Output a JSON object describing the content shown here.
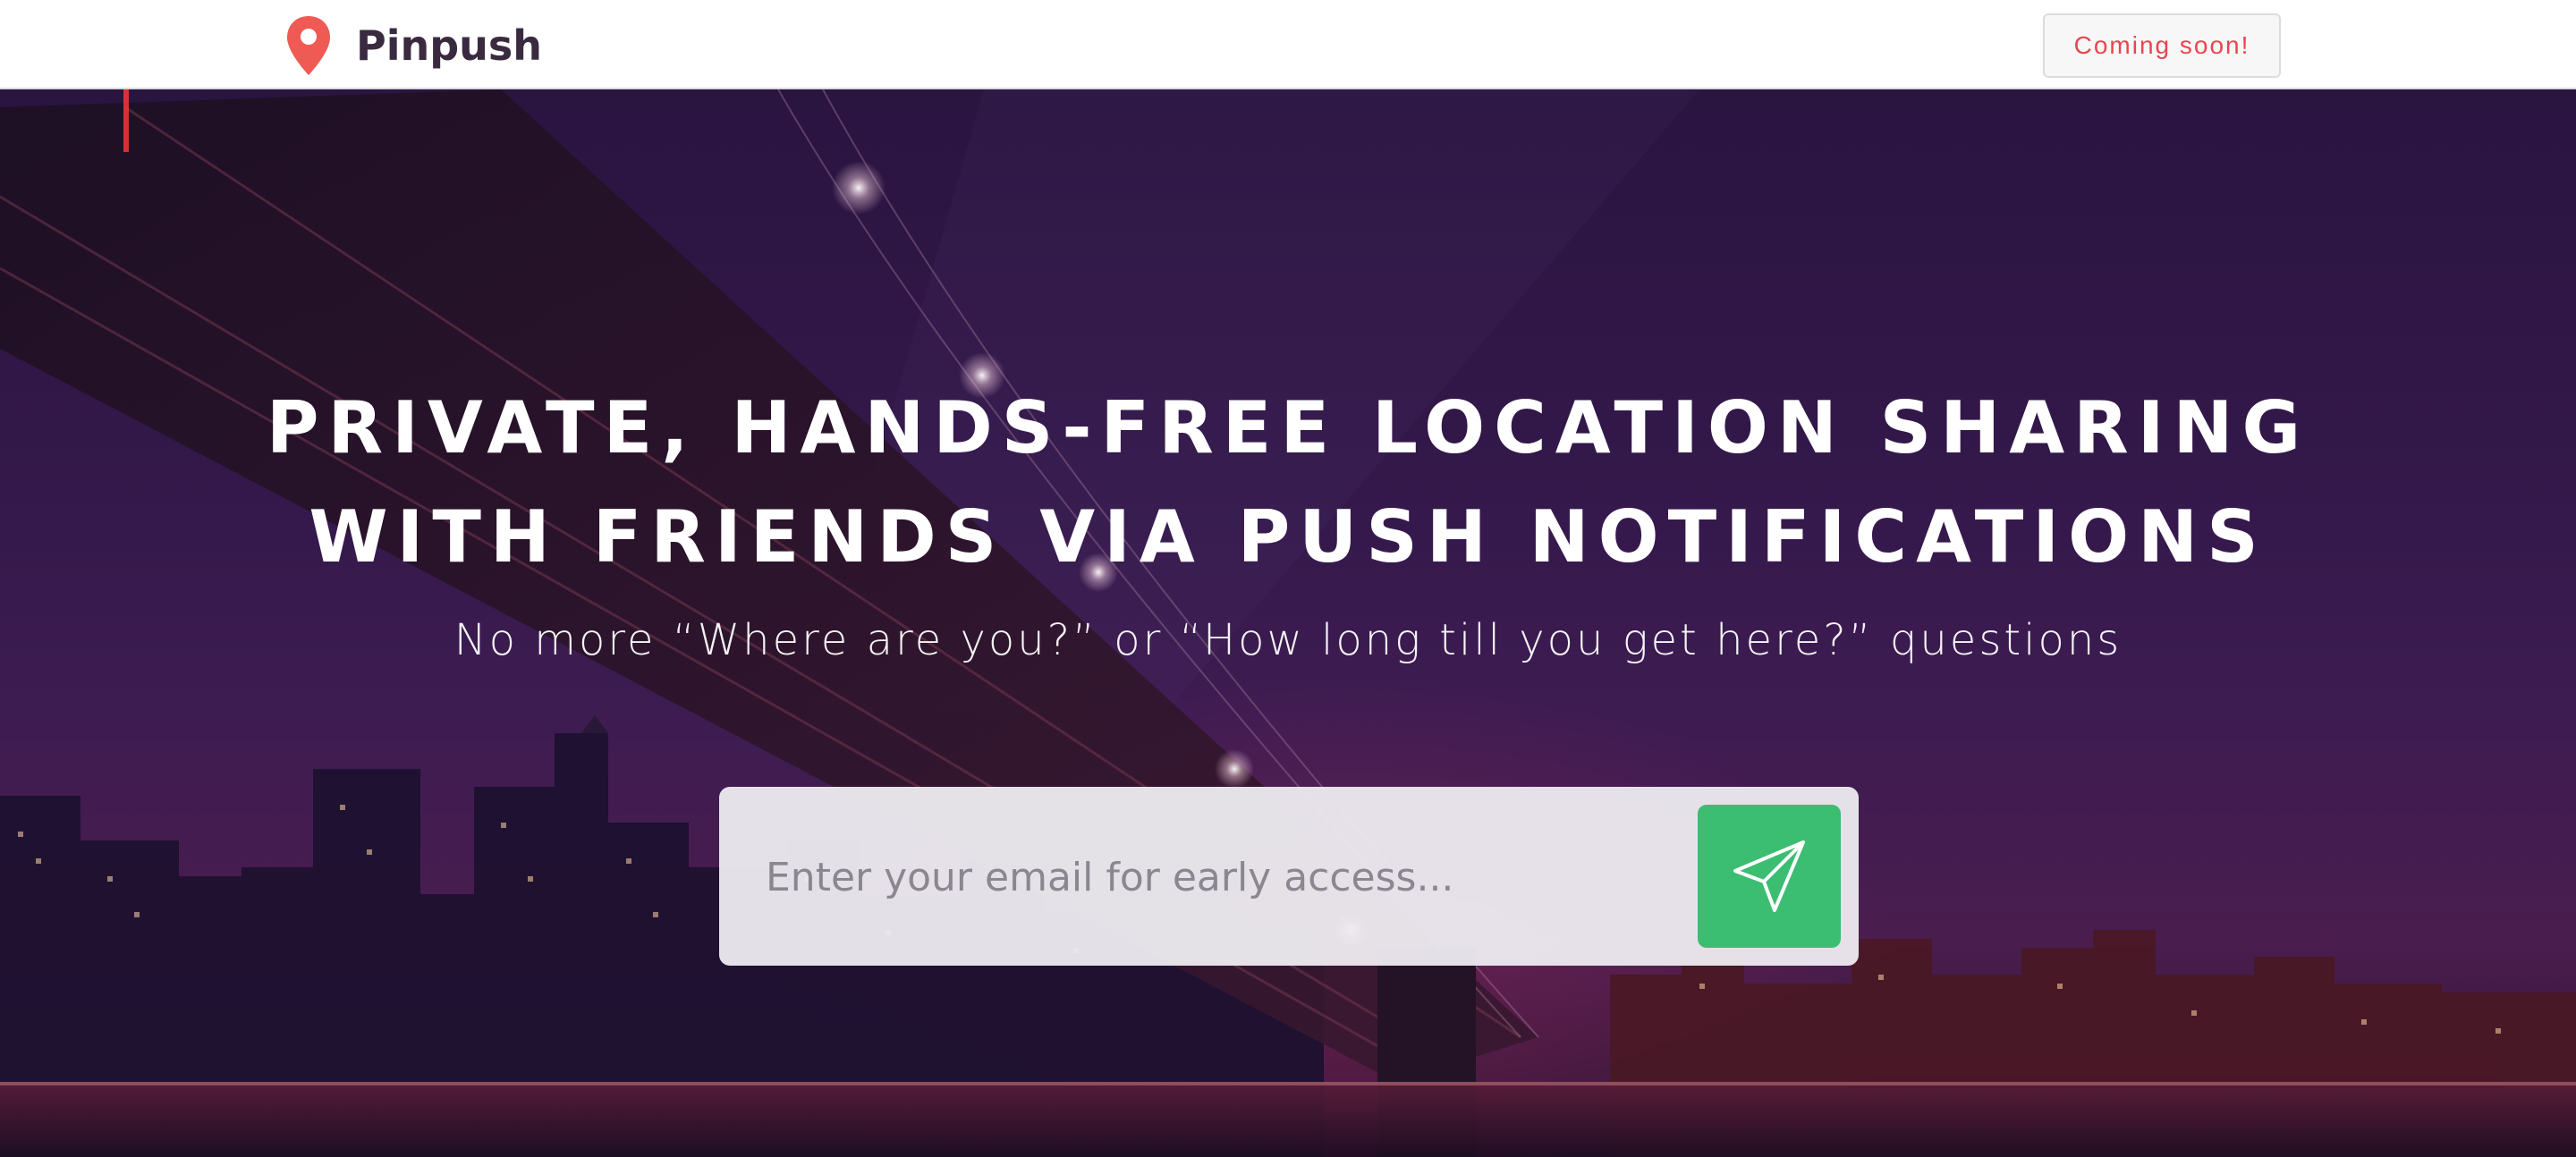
{
  "header": {
    "brand_name": "Pinpush",
    "logo_icon": "map-pin-icon",
    "coming_soon_label": "Coming soon!"
  },
  "hero": {
    "headline_line1": "PRIVATE, HANDS-FREE LOCATION SHARING",
    "headline_line2": "WITH FRIENDS VIA PUSH NOTIFICATIONS",
    "subheadline": "No more “Where are you?” or “How long till you get here?” questions",
    "background_image": "night city skyline with bridge"
  },
  "signup": {
    "email_placeholder": "Enter your email for early access...",
    "email_value": "",
    "submit_icon": "paper-plane-icon"
  },
  "colors": {
    "accent_red": "#E8464E",
    "brand_text": "#3A2A40",
    "submit_green": "#3BBD72",
    "hero_overlay": "#34184A"
  }
}
